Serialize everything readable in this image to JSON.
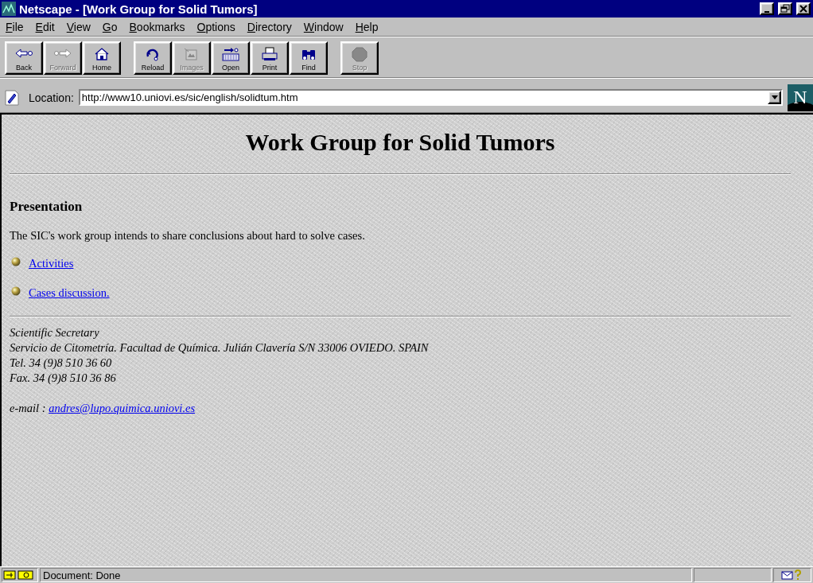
{
  "window": {
    "title": "Netscape - [Work Group for Solid Tumors]"
  },
  "menu": [
    "File",
    "Edit",
    "View",
    "Go",
    "Bookmarks",
    "Options",
    "Directory",
    "Window",
    "Help"
  ],
  "toolbar": {
    "groups": [
      [
        {
          "label": "Back",
          "kind": "back",
          "disabled": false
        },
        {
          "label": "Forward",
          "kind": "forward",
          "disabled": true
        },
        {
          "label": "Home",
          "kind": "home",
          "disabled": false
        }
      ],
      [
        {
          "label": "Reload",
          "kind": "reload",
          "disabled": false
        },
        {
          "label": "Images",
          "kind": "images",
          "disabled": true
        },
        {
          "label": "Open",
          "kind": "open",
          "disabled": false
        },
        {
          "label": "Print",
          "kind": "print",
          "disabled": false
        },
        {
          "label": "Find",
          "kind": "find",
          "disabled": false
        }
      ],
      [
        {
          "label": "Stop",
          "kind": "stop",
          "disabled": true
        }
      ]
    ]
  },
  "location": {
    "label": "Location:",
    "value": "http://www10.uniovi.es/sic/english/solidtum.htm",
    "logo_letter": "N"
  },
  "page": {
    "heading": "Work Group for Solid Tumors",
    "section_title": "Presentation",
    "intro": "The SIC's work group intends to share conclusions about hard to solve cases.",
    "links": [
      "Activities",
      "Cases discussion."
    ],
    "address_lines": [
      "Scientific Secretary",
      "Servicio de Citometría. Facultad de Química. Julián Clavería S/N 33006 OVIEDO. SPAIN",
      "Tel. 34 (9)8 510 36 60",
      "Fax. 34 (9)8 510 36 86"
    ],
    "email_label": "e-mail :",
    "email": "andres@lupo.quimica.uniovi.es"
  },
  "status_bar": {
    "text": "Document: Done"
  }
}
